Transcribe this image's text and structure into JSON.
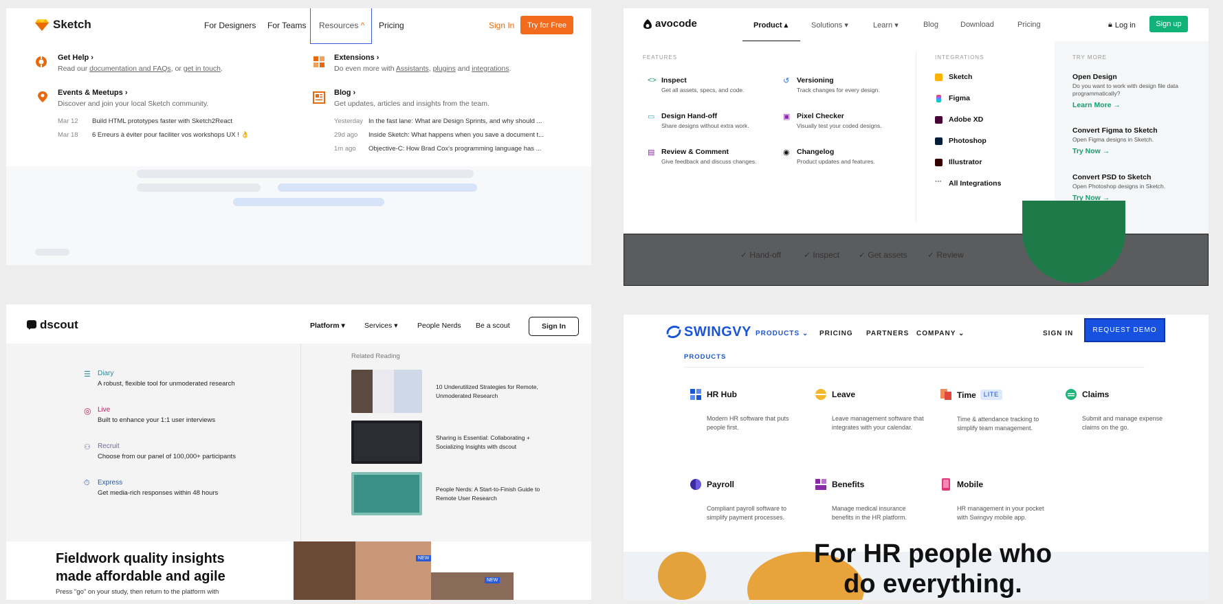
{
  "sketch": {
    "logo": "Sketch",
    "nav": [
      "For Designers",
      "For Teams",
      "Resources",
      "Pricing"
    ],
    "signin": "Sign In",
    "try": "Try for Free",
    "get_help": {
      "title": "Get Help",
      "pre": "Read our ",
      "l1": "documentation and FAQs",
      "mid": ", or ",
      "l2": "get in touch",
      "post": "."
    },
    "events": {
      "title": "Events & Meetups",
      "desc": "Discover and join your local Sketch community."
    },
    "extensions": {
      "title": "Extensions",
      "pre": "Do even more with ",
      "l1": "Assistants",
      "c": ", ",
      "l2": "plugins",
      "and": " and ",
      "l3": "integrations",
      "post": "."
    },
    "blog": {
      "title": "Blog",
      "desc": "Get updates, articles and insights from the team."
    },
    "events_posts": [
      {
        "date": "Mar 12",
        "text": "Build HTML prototypes faster with Sketch2React"
      },
      {
        "date": "Mar 18",
        "text": "6 Erreurs à éviter pour faciliter vos workshops UX ! 👌"
      }
    ],
    "blog_posts": [
      {
        "date": "Yesterday",
        "text": "In the fast lane: What are Design Sprints, and why should ..."
      },
      {
        "date": "29d ago",
        "text": "Inside Sketch: What happens when you save a document t..."
      },
      {
        "date": "1m ago",
        "text": "Objective-C: How Brad Cox's programming language has ..."
      }
    ]
  },
  "avocode": {
    "logo": "avocode",
    "nav": [
      "Product",
      "Solutions",
      "Learn",
      "Blog",
      "Download",
      "Pricing"
    ],
    "login": "Log in",
    "signup": "Sign up",
    "features_label": "FEATURES",
    "integrations_label": "INTEGRATIONS",
    "trymore_label": "TRY MORE",
    "features": [
      {
        "title": "Inspect",
        "desc": "Get all assets, specs, and code."
      },
      {
        "title": "Versioning",
        "desc": "Track changes for every design."
      },
      {
        "title": "Design Hand-off",
        "desc": "Share designs without extra work."
      },
      {
        "title": "Pixel Checker",
        "desc": "Visually test your coded designs."
      },
      {
        "title": "Review & Comment",
        "desc": "Give feedback and discuss changes."
      },
      {
        "title": "Changelog",
        "desc": "Product updates and features."
      }
    ],
    "integrations": [
      "Sketch",
      "Figma",
      "Adobe XD",
      "Photoshop",
      "Illustrator",
      "All Integrations"
    ],
    "trymore": [
      {
        "title": "Open Design",
        "desc": "Do you want to work with design file data programmatically?",
        "link": "Learn More →"
      },
      {
        "title": "Convert Figma to Sketch",
        "desc": "Open Figma designs in Sketch.",
        "link": "Try Now →"
      },
      {
        "title": "Convert PSD to Sketch",
        "desc": "Open Photoshop designs in Sketch.",
        "link": "Try Now →"
      }
    ],
    "checks": [
      "Hand-off",
      "Inspect",
      "Get assets",
      "Review"
    ]
  },
  "dscout": {
    "logo": "dscout",
    "nav": [
      "Platform",
      "Services",
      "People Nerds",
      "Be a scout"
    ],
    "signin": "Sign In",
    "products": [
      {
        "title": "Diary",
        "desc": "A robust, flexible tool for unmoderated research",
        "color": "#2a8a94"
      },
      {
        "title": "Live",
        "desc": "Built to enhance your 1:1 user interviews",
        "color": "#c2185b"
      },
      {
        "title": "Recruit",
        "desc": "Choose from our panel of 100,000+ participants",
        "color": "#6b6b9a"
      },
      {
        "title": "Express",
        "desc": "Get media-rich responses within 48 hours",
        "color": "#2a5aa0"
      }
    ],
    "related_label": "Related Reading",
    "articles": [
      {
        "title": "10 Underutilized Strategies for Remote, Unmoderated Research"
      },
      {
        "title": "Sharing is Essential: Collaborating + Socializing Insights with dscout"
      },
      {
        "title": "People Nerds: A Start-to-Finish Guide to Remote User Research"
      }
    ],
    "hero_title": "Fieldwork quality insights made affordable and agile",
    "hero_text": "Press \"go\" on your study, then return to the platform with",
    "badge": "NEW"
  },
  "swingvy": {
    "logo": "SWINGVY",
    "nav": [
      "PRODUCTS",
      "PRICING",
      "PARTNERS",
      "COMPANY"
    ],
    "signin": "SIGN IN",
    "demo": "REQUEST DEMO",
    "products_label": "PRODUCTS",
    "products": [
      {
        "title": "HR Hub",
        "desc": "Modern HR software that puts people first.",
        "badge": ""
      },
      {
        "title": "Leave",
        "desc": "Leave management software that integrates with your calendar.",
        "badge": ""
      },
      {
        "title": "Time",
        "desc": "Time & attendance tracking to simplify team management.",
        "badge": "LITE"
      },
      {
        "title": "Claims",
        "desc": "Submit and manage expense claims on the go.",
        "badge": ""
      },
      {
        "title": "Payroll",
        "desc": "Compliant payroll software to simplify payment processes.",
        "badge": ""
      },
      {
        "title": "Benefits",
        "desc": "Manage medical insurance benefits in the HR platform.",
        "badge": ""
      },
      {
        "title": "Mobile",
        "desc": "HR management in your pocket with Swingvy mobile app.",
        "badge": ""
      }
    ],
    "hero": "For HR people who do everything."
  }
}
